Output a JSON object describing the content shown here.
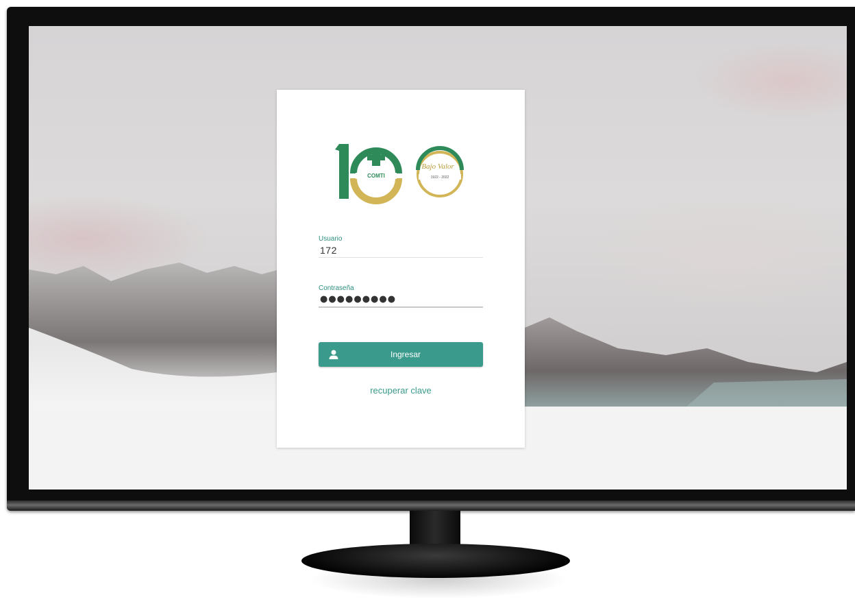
{
  "login": {
    "username_label": "Usuario",
    "username_value": "172",
    "password_label": "Contraseña",
    "password_value": "●●●●●●●●●",
    "submit_label": "Ingresar",
    "recover_link": "recuperar clave"
  },
  "logo": {
    "number": "100",
    "org_text": "COMTI",
    "script_text": "Bajo Valor",
    "years_text": "1922 - 2022"
  },
  "icons": {
    "submit_icon": "user-icon"
  },
  "colors": {
    "accent": "#3a9a8b",
    "logo_green": "#2f8a5a",
    "logo_gold": "#d2b556"
  }
}
